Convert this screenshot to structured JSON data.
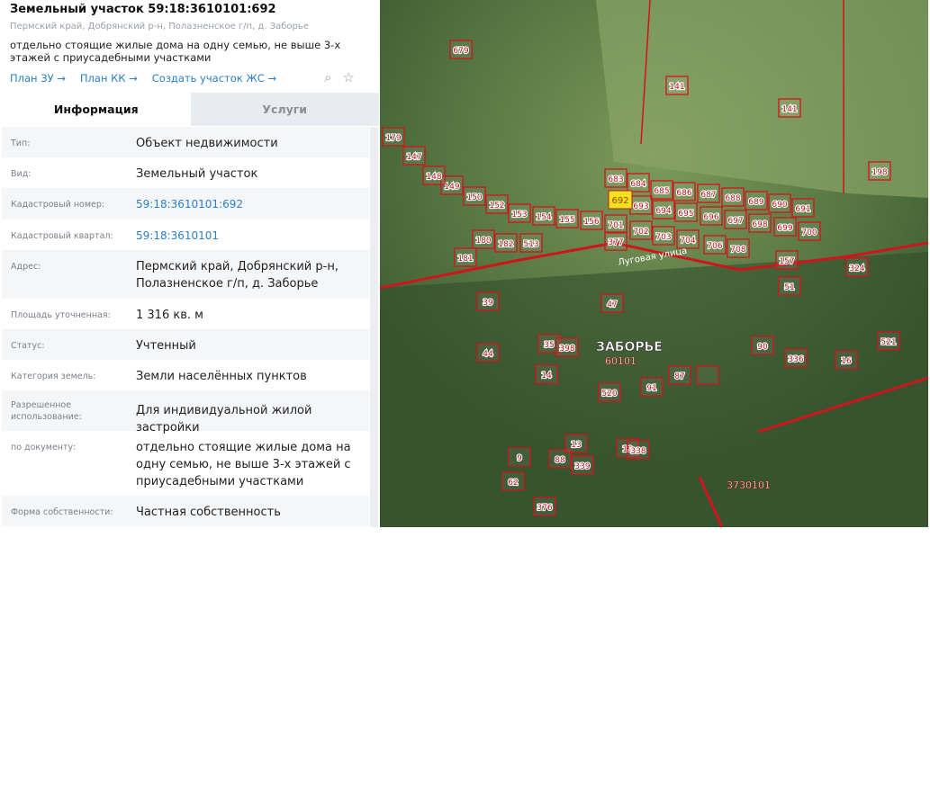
{
  "header": {
    "title": "Земельный участок 59:18:3610101:692",
    "address": "Пермский край, Добрянский р-н, Полазненское г/п, д. Заборье",
    "description": "отдельно стоящие жилые дома на одну семью, не выше 3-х этажей с приусадебными участками",
    "links": [
      "План ЗУ →",
      "План КК →",
      "Создать участок ЖС →"
    ]
  },
  "tabs": [
    {
      "label": "Информация",
      "active": true
    },
    {
      "label": "Услуги",
      "active": false
    }
  ],
  "info": [
    {
      "label": "Тип:",
      "value": "Объект недвижимости"
    },
    {
      "label": "Вид:",
      "value": "Земельный участок"
    },
    {
      "label": "Кадастровый номер:",
      "value": "59:18:3610101:692"
    },
    {
      "label": "Кадастровый квартал:",
      "value": "59:18:3610101"
    },
    {
      "label": "Адрес:",
      "value": "Пермский край, Добрянский р-н, Полазненское г/п, д. Заборье"
    },
    {
      "label": "Площадь уточненная:",
      "value": "1 316 кв. м"
    },
    {
      "label": "Статус:",
      "value": "Учтенный"
    },
    {
      "label": "Категория земель:",
      "value": "Земли населённых пунктов"
    },
    {
      "label": "Разрешенное использование:",
      "value": "Для индивидуальной жилой застройки"
    },
    {
      "label": "по документу:",
      "value": "отдельно стоящие жилые дома на одну семью, не выше 3-х этажей с приусадебными участками"
    },
    {
      "label": "Форма собственности:",
      "value": "Частная собственность"
    }
  ],
  "map": {
    "village": "ЗАБОРЬЕ",
    "quarter": "60101",
    "quarter2": "3730101",
    "street": "Луговая улица",
    "selected_parcel": "692",
    "parcels": [
      "679",
      "141",
      "141",
      "198",
      "683",
      "684",
      "685",
      "686",
      "687",
      "688",
      "689",
      "690",
      "691",
      "693",
      "694",
      "695",
      "696",
      "697",
      "698",
      "699",
      "700",
      "701",
      "702",
      "703",
      "704",
      "706",
      "708",
      "377",
      "157",
      "156",
      "155",
      "154",
      "153",
      "152",
      "150",
      "149",
      "148",
      "147",
      "179",
      "180",
      "181",
      "182",
      "513",
      "47",
      "39",
      "44",
      "35",
      "398",
      "14",
      "520",
      "19",
      "338",
      "339",
      "88",
      "13",
      "9",
      "62",
      "376",
      "90",
      "336",
      "16",
      "521",
      "51",
      "324",
      "91",
      "87"
    ],
    "colors": {
      "parcel": "#d0141c",
      "highlight": "#f2e21b"
    }
  }
}
